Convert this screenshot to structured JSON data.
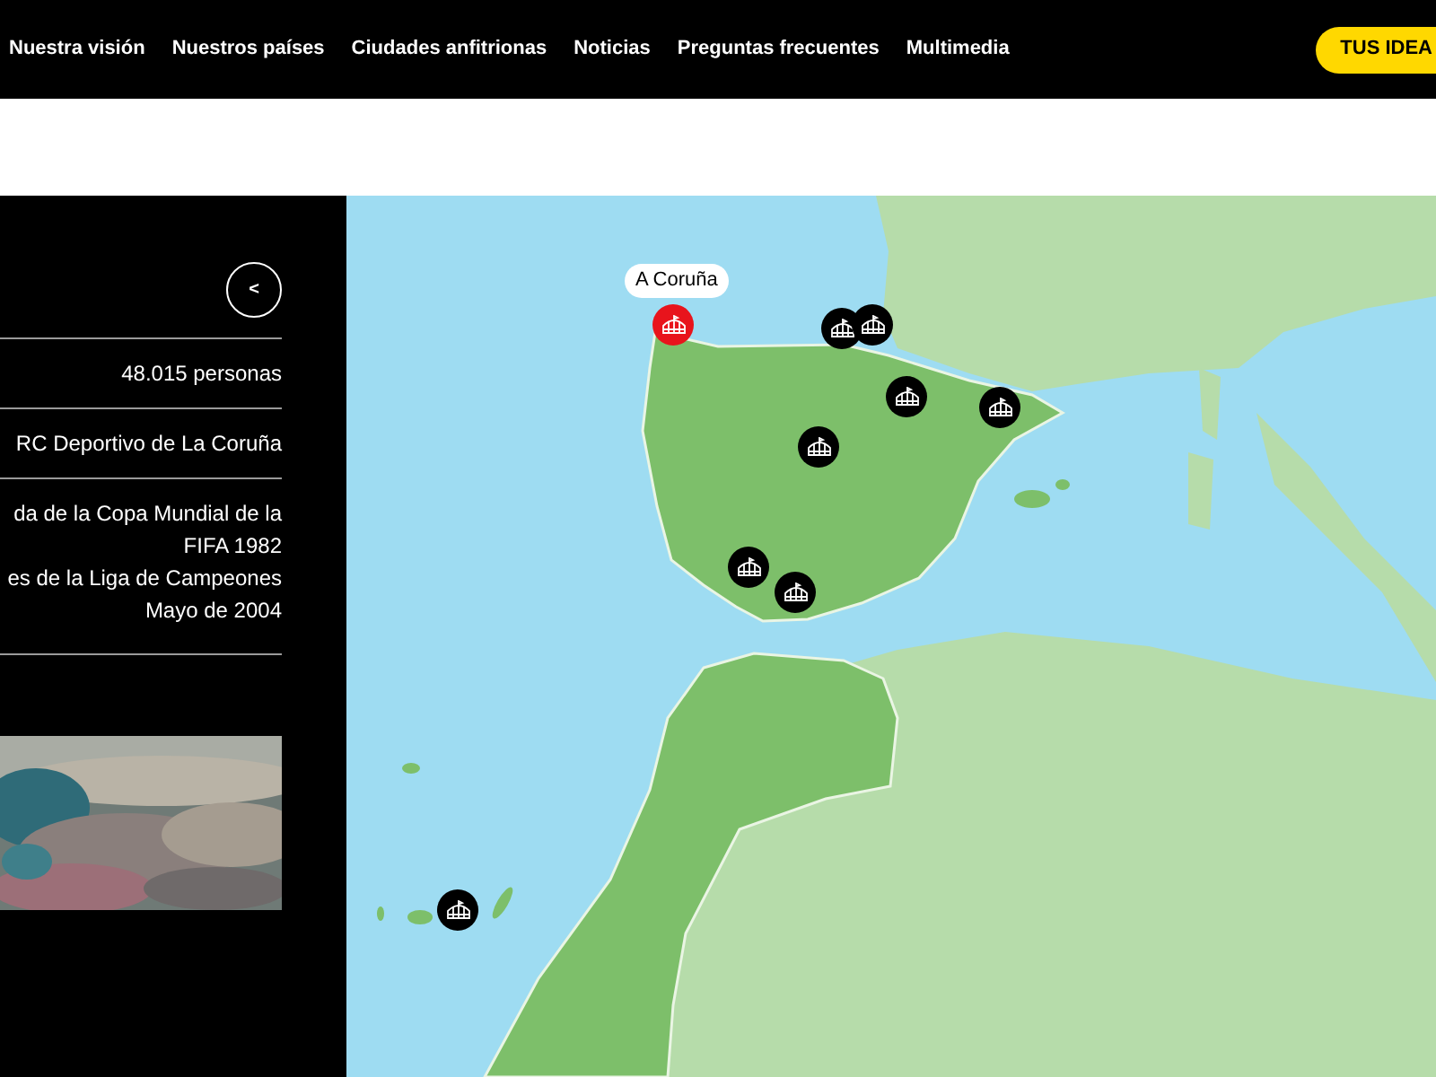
{
  "nav": {
    "links": [
      "Nuestra visión",
      "Nuestros países",
      "Ciudades anfitrionas",
      "Noticias",
      "Preguntas frecuentes",
      "Multimedia"
    ],
    "cta": "TUS IDEA"
  },
  "sidebar": {
    "back": "<",
    "rows": [
      {
        "lines": [
          "48.015 personas"
        ]
      },
      {
        "lines": [
          "RC Deportivo de La Coruña"
        ]
      },
      {
        "lines": [
          "da de la Copa Mundial de la",
          "FIFA 1982",
          "es de la Liga de Campeones",
          "Mayo de 2004"
        ]
      }
    ]
  },
  "map": {
    "markers": [
      {
        "label": "A Coruña",
        "selected": true
      },
      {
        "selected": false
      },
      {
        "selected": false
      },
      {
        "selected": false
      },
      {
        "selected": false
      },
      {
        "selected": false
      },
      {
        "selected": false
      },
      {
        "selected": false
      },
      {
        "selected": false
      }
    ]
  }
}
